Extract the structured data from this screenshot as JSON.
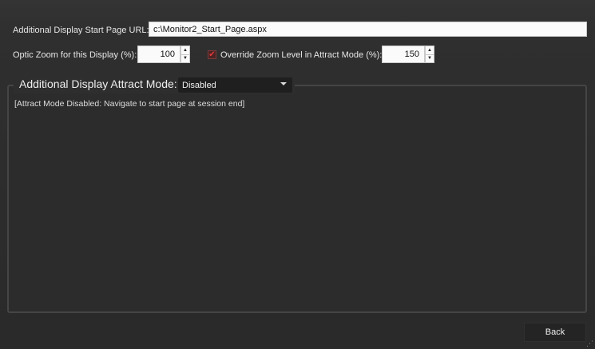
{
  "start_page": {
    "label": "Additional Display Start Page URL:",
    "value": "c:\\Monitor2_Start_Page.aspx"
  },
  "optic_zoom": {
    "label": "Optic Zoom for this Display (%):",
    "value": "100",
    "up_glyph": "▲",
    "down_glyph": "▼"
  },
  "override_zoom": {
    "checked": true,
    "check_glyph": "✔",
    "label": "Override Zoom Level in Attract Mode (%):",
    "value": "150",
    "up_glyph": "▲",
    "down_glyph": "▼"
  },
  "attract_mode": {
    "title": "Additional Display Attract Mode:",
    "selected": "Disabled",
    "status": "[Attract Mode Disabled: Navigate to start page at session end]"
  },
  "footer": {
    "back_label": "Back",
    "grip_glyph": "⋰"
  },
  "colors": {
    "background": "#2e2e2e",
    "checkbox_accent": "#e23a3a",
    "input_background": "#fafafa"
  }
}
